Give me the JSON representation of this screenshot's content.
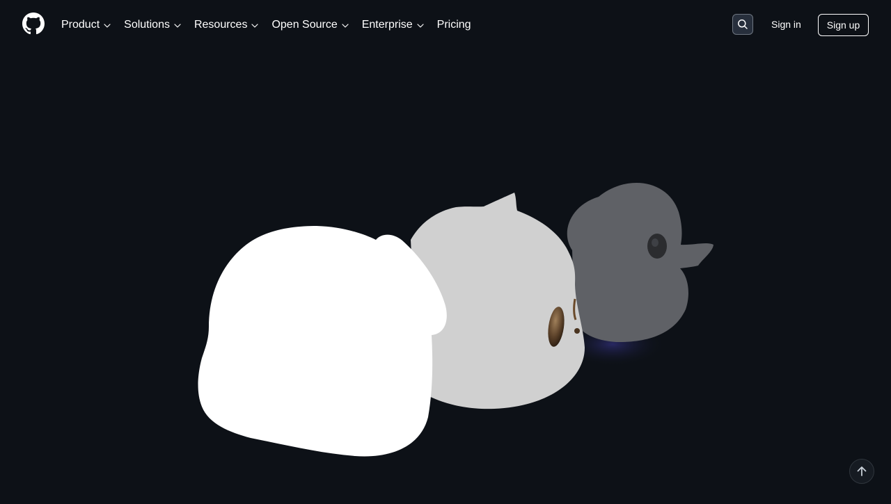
{
  "header": {
    "logo_icon": "github-mark-icon",
    "nav": [
      {
        "label": "Product",
        "has_dropdown": true
      },
      {
        "label": "Solutions",
        "has_dropdown": true
      },
      {
        "label": "Resources",
        "has_dropdown": true
      },
      {
        "label": "Open Source",
        "has_dropdown": true
      },
      {
        "label": "Enterprise",
        "has_dropdown": true
      },
      {
        "label": "Pricing",
        "has_dropdown": false
      }
    ],
    "search_icon": "search-icon",
    "sign_in": "Sign in",
    "sign_up": "Sign up"
  },
  "hero": {
    "illustration": "three-ducks-3d-illustration",
    "colors": {
      "background": "#0d1117",
      "duck_front": "#ffffff",
      "duck_middle": "#d0d0d0",
      "duck_back": "#5f6166"
    }
  },
  "scroll_top_icon": "arrow-up-icon"
}
